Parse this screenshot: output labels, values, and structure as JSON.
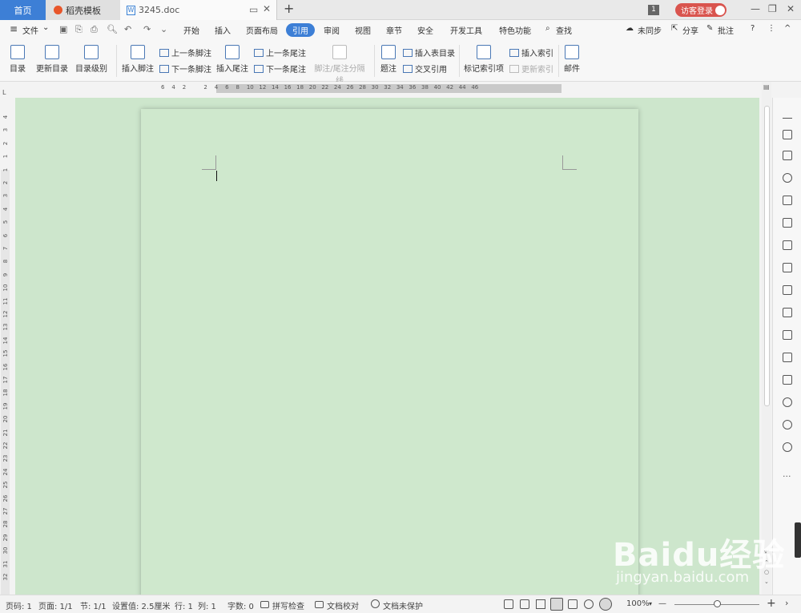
{
  "tabs": {
    "home": "首页",
    "daoke": "稻壳模板",
    "doc": "3245.doc",
    "add": "+"
  },
  "titlebar": {
    "window_count": "1",
    "login": "访客登录",
    "minimize": "—",
    "restore": "❐",
    "close": "✕"
  },
  "menubar": {
    "file": "文件",
    "items": [
      "开始",
      "插入",
      "页面布局",
      "引用",
      "审阅",
      "视图",
      "章节",
      "安全",
      "开发工具",
      "特色功能"
    ],
    "active": "引用",
    "search": "查找",
    "unsynced": "未同步",
    "share": "分享",
    "comment": "批注",
    "help": "?",
    "more": "⋮",
    "collapse": "^"
  },
  "ribbon": {
    "toc": "目录",
    "update_toc": "更新目录",
    "toc_level": "目录级别",
    "insert_footnote": "插入脚注",
    "prev_footnote": "上一条脚注",
    "next_footnote": "下一条脚注",
    "insert_endnote": "插入尾注",
    "prev_endnote": "上一条尾注",
    "next_endnote": "下一条尾注",
    "note_separator": "脚注/尾注分隔线",
    "caption": "题注",
    "insert_table_of_figures": "插入表目录",
    "cross_reference": "交叉引用",
    "mark_index_entry": "标记索引项",
    "insert_index": "插入索引",
    "update_index": "更新索引",
    "mail": "邮件"
  },
  "ruler": {
    "horizontal_ticks": "6    4    2          2    4    6    8    10   12   14   16   18   20   22   24   26   28   30   32   34   36   38   40   42   44   46",
    "vertical_ticks": [
      "4",
      "3",
      "2",
      "1",
      "1",
      "2",
      "3",
      "4",
      "5",
      "6",
      "7",
      "8",
      "9",
      "10",
      "11",
      "12",
      "13",
      "14",
      "15",
      "16",
      "17",
      "18",
      "19",
      "20",
      "21",
      "22",
      "23",
      "24",
      "25",
      "26",
      "27",
      "28",
      "29",
      "30",
      "31",
      "32"
    ],
    "corner": "L"
  },
  "statusbar": {
    "page_code": "页码: 1",
    "page": "页面: 1/1",
    "section": "节: 1/1",
    "setting": "设置值: 2.5厘米",
    "row": "行: 1",
    "col": "列: 1",
    "word_count": "字数: 0",
    "spellcheck": "拼写检查",
    "doc_proof": "文档校对",
    "doc_unprotected": "文档未保护",
    "zoom": "100%",
    "zoom_minus": "—",
    "zoom_plus": "+"
  },
  "watermark": {
    "brand": "Baidu经验",
    "url": "jingyan.baidu.com"
  }
}
